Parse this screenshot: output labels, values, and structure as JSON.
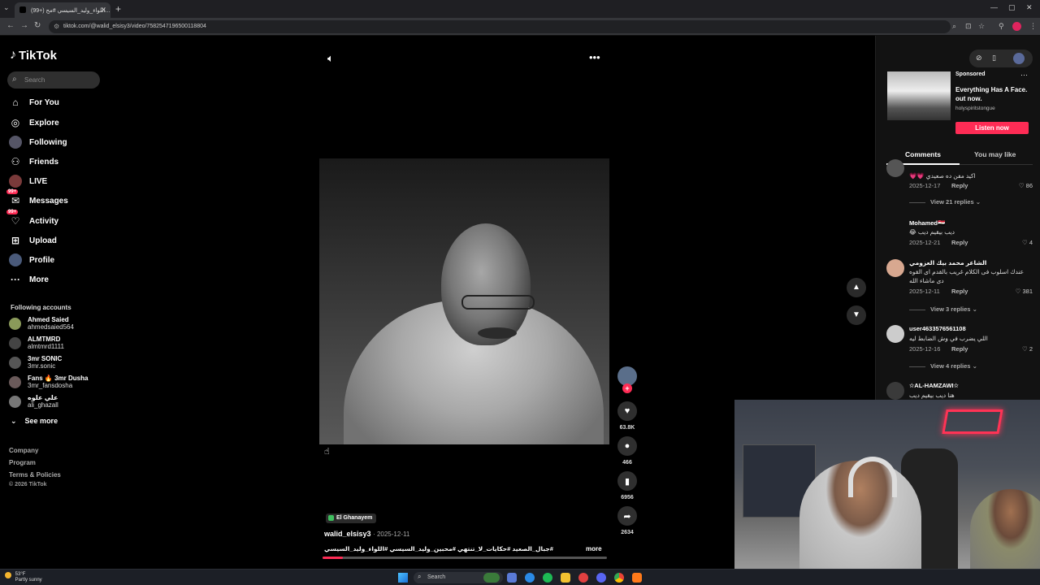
{
  "browser": {
    "tab_title": "(99+) اللواء_وليد_السيسي #مح...",
    "url": "tiktok.com/@walid_elsisy3/video/7582547196500118804"
  },
  "sidebar": {
    "logo": "TikTok",
    "search_placeholder": "Search",
    "nav": [
      {
        "label": "For You",
        "icon": "home-icon"
      },
      {
        "label": "Explore",
        "icon": "compass-icon"
      },
      {
        "label": "Following",
        "icon": "following-avatar-icon"
      },
      {
        "label": "Friends",
        "icon": "friends-icon"
      },
      {
        "label": "LIVE",
        "icon": "live-icon"
      },
      {
        "label": "Messages",
        "icon": "messages-icon",
        "badge": "99+"
      },
      {
        "label": "Activity",
        "icon": "activity-icon",
        "badge": "99+"
      },
      {
        "label": "Upload",
        "icon": "upload-icon"
      },
      {
        "label": "Profile",
        "icon": "profile-icon"
      },
      {
        "label": "More",
        "icon": "more-icon"
      }
    ],
    "following_title": "Following accounts",
    "accounts": [
      {
        "name": "Ahmed Saied",
        "handle": "ahmedsaied564"
      },
      {
        "name": "ALMTMRD",
        "handle": "almtmrd1111"
      },
      {
        "name": "3mr SONIC",
        "handle": "3mr.sonic"
      },
      {
        "name": "Fans 🔥 3mr Dusha",
        "handle": "3mr_fansdosha"
      },
      {
        "name": "علي علوه",
        "handle": "ali_ghazall"
      }
    ],
    "see_more": "See more",
    "footer": [
      "Company",
      "Program",
      "Terms & Policies"
    ],
    "copyright": "© 2026 TikTok"
  },
  "video": {
    "channel_tag": "El Ghanayem",
    "author": "walid_elsisy3",
    "date": "2025-12-11",
    "caption": "#جبال_الصعيد #حكايات_لا_تنتهي #محبين_وليد_السيسي #اللواء_وليد_السيسي",
    "more_label": "more",
    "progress": 0.07,
    "likes": "63.8K",
    "comments": "466",
    "saves": "6956",
    "shares": "2634"
  },
  "ad": {
    "sponsored": "Sponsored",
    "title": "Everything Has A Face. out now.",
    "handle": "holyspiritstongue",
    "cta": "Listen now"
  },
  "tabs": {
    "comments": "Comments",
    "you_may_like": "You may like"
  },
  "comments": [
    {
      "user": "",
      "text": "اكيد مفن ده صعيدي 💗💗",
      "date": "2025-12-17",
      "likes": "86",
      "replies": "View 21 replies"
    },
    {
      "user": "Mohamed🇪🇬",
      "text": "ديب بيقيم ديب 😂",
      "date": "2025-12-21",
      "likes": "4",
      "replies": ""
    },
    {
      "user": "الشاعر محمد بيك العزومي",
      "text": "عندك اسلوب فى الكلام غريب بالقدم اى القوه",
      "text2": "دى ماشاء الله",
      "date": "2025-12-11",
      "likes": "381",
      "replies": "View 3 replies"
    },
    {
      "user": "user4633576561108",
      "text": "اللي يضرب في وش الضابط ليه",
      "date": "2025-12-16",
      "likes": "2",
      "replies": "View 4 replies"
    },
    {
      "user": "✫AL-HAMZAWI✫",
      "text": "هنا ديب بيقيم ديب",
      "date": "",
      "likes": "",
      "replies": ""
    }
  ],
  "comment_actions": {
    "reply": "Reply"
  },
  "taskbar": {
    "temp": "53°F",
    "weather": "Partly sunny",
    "search": "Search"
  },
  "colors": {
    "accent": "#fe2c55",
    "background": "#000000",
    "panel": "#121212"
  }
}
